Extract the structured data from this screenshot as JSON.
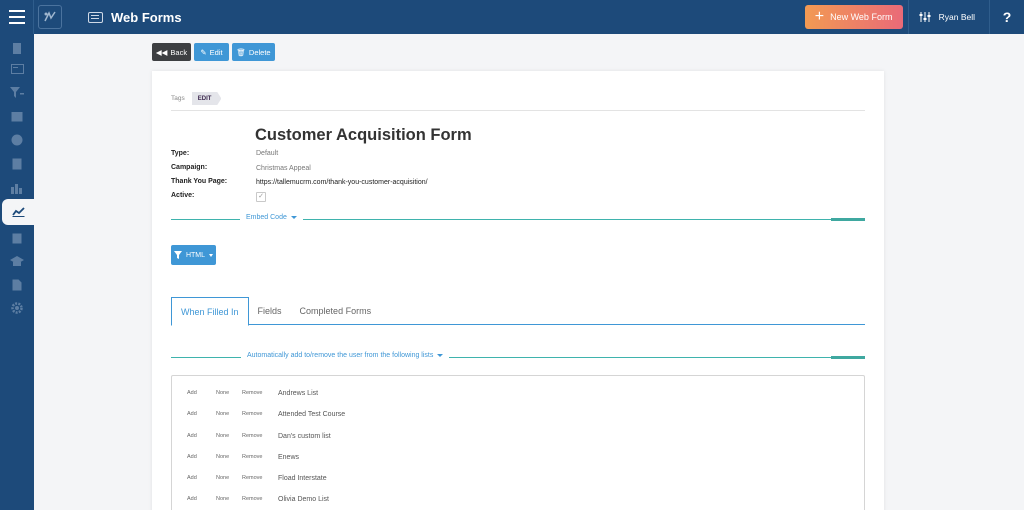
{
  "header": {
    "page_title": "Web Forms",
    "new_button_label": "New Web Form",
    "user_name": "Ryan Bell",
    "help_label": "?"
  },
  "sidebar": {
    "items": [
      "building-icon",
      "card-icon",
      "funnel-icon",
      "calendar-icon",
      "dollar-icon",
      "document-icon",
      "bar-chart-icon",
      "trend-chart-icon",
      "clipboard-icon",
      "graduation-cap-icon",
      "file-icon",
      "gear-icon"
    ],
    "active_index": 7
  },
  "toolbar": {
    "back_label": "Back",
    "edit_label": "Edit",
    "delete_label": "Delete"
  },
  "record": {
    "tags_label": "Tags",
    "tag": "EDIT",
    "title": "Customer Acquisition Form",
    "fields": [
      {
        "label": "Type:",
        "value": "Default"
      },
      {
        "label": "Campaign:",
        "value": "Christmas Appeal"
      },
      {
        "label": "Thank You Page:",
        "value": "https://tallemucrm.com/thank-you-customer-acquisition/"
      },
      {
        "label": "Active:",
        "value": "✓"
      }
    ]
  },
  "embed": {
    "section_label": "Embed Code",
    "format_button": "HTML"
  },
  "tabs": [
    {
      "label": "When Filled In",
      "active": true
    },
    {
      "label": "Fields",
      "active": false
    },
    {
      "label": "Completed Forms",
      "active": false
    }
  ],
  "lists_section": {
    "label": "Automatically add to/remove the user from the following lists",
    "option_labels": [
      "Add",
      "None",
      "Remove"
    ],
    "lists": [
      "Andrews List",
      "Attended Test Course",
      "Dan's custom list",
      "Enews",
      "Fload Interstate",
      "Olivia Demo List"
    ]
  },
  "colors": {
    "nav": "#1d4a7a",
    "primary": "#3f97d6",
    "teal": "#3fa8a0",
    "accent_start": "#f29a53",
    "accent_end": "#e96a78"
  }
}
